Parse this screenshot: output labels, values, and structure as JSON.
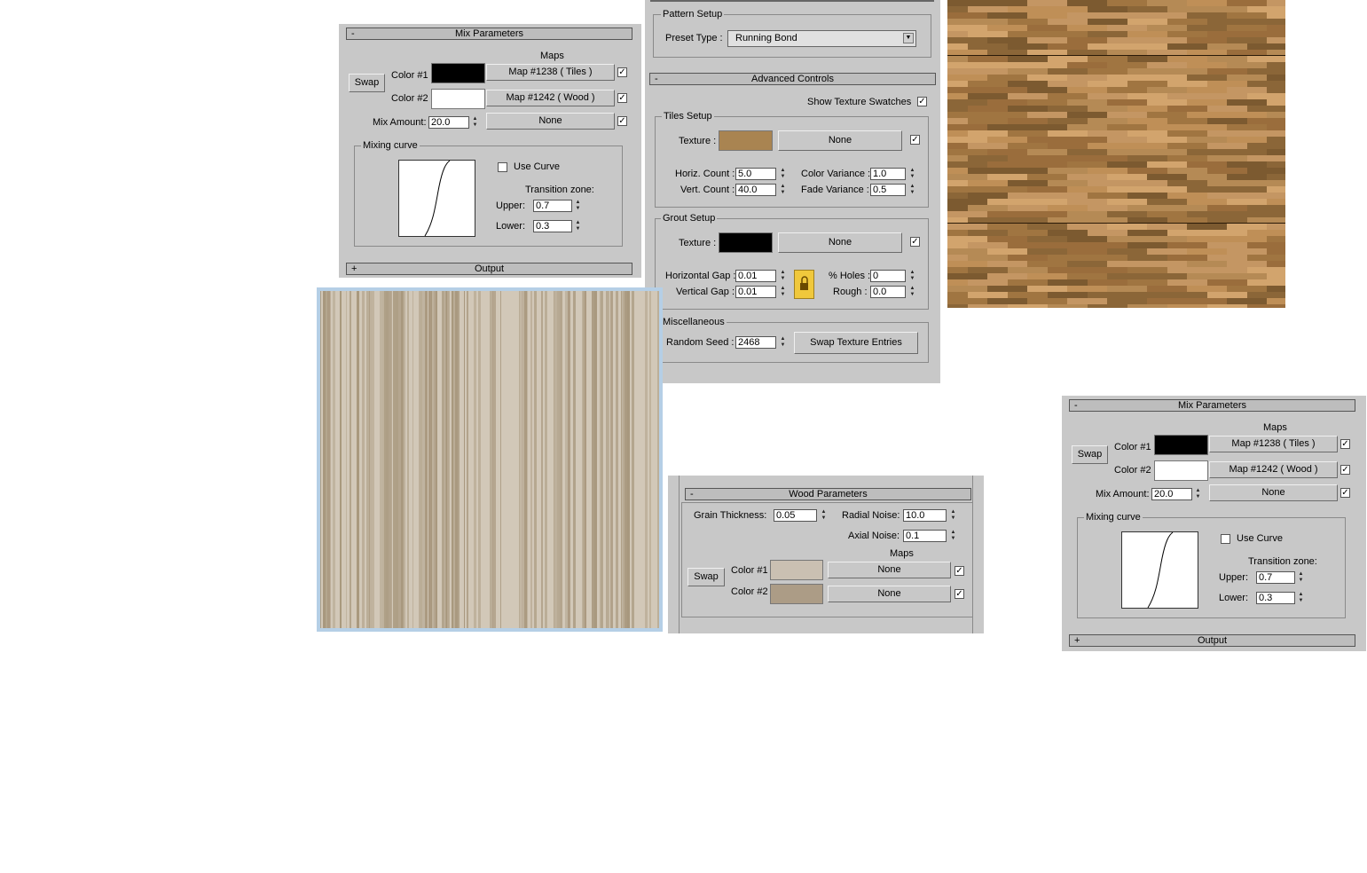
{
  "mix1": {
    "title": "Mix Parameters",
    "collapse_sign": "-",
    "maps_header": "Maps",
    "swap_label": "Swap",
    "color1_label": "Color #1",
    "color1_hex": "#000000",
    "color1_map": "Map #1238  ( Tiles )",
    "color2_label": "Color #2",
    "color2_hex": "#ffffff",
    "color2_map": "Map #1242  ( Wood )",
    "mix_amount_label": "Mix Amount:",
    "mix_amount_value": "20.0",
    "mix_map": "None",
    "mixing_curve_label": "Mixing curve",
    "use_curve_label": "Use Curve",
    "transition_zone_label": "Transition zone:",
    "upper_label": "Upper:",
    "upper_value": "0.7",
    "lower_label": "Lower:",
    "lower_value": "0.3",
    "output_label": "Output",
    "output_sign": "+",
    "check_mark": "✓"
  },
  "mix2": {
    "title": "Mix Parameters",
    "collapse_sign": "-",
    "maps_header": "Maps",
    "swap_label": "Swap",
    "color1_label": "Color #1",
    "color1_hex": "#000000",
    "color1_map": "Map #1238  ( Tiles )",
    "color2_label": "Color #2",
    "color2_hex": "#ffffff",
    "color2_map": "Map #1242  ( Wood )",
    "mix_amount_label": "Mix Amount:",
    "mix_amount_value": "20.0",
    "mix_map": "None",
    "mixing_curve_label": "Mixing curve",
    "use_curve_label": "Use Curve",
    "transition_zone_label": "Transition zone:",
    "upper_label": "Upper:",
    "upper_value": "0.7",
    "lower_label": "Lower:",
    "lower_value": "0.3",
    "output_label": "Output",
    "output_sign": "+",
    "check_mark": "✓"
  },
  "tiles": {
    "pattern_setup_label": "Pattern Setup",
    "preset_type_label": "Preset Type :",
    "preset_type_value": "Running Bond",
    "advanced_controls_title": "Advanced Controls",
    "collapse_sign": "-",
    "show_swatches_label": "Show Texture Swatches",
    "tiles_setup_label": "Tiles Setup",
    "tiles_texture_label": "Texture :",
    "tiles_texture_hex": "#a98451",
    "tiles_texture_map": "None",
    "horiz_count_label": "Horiz. Count :",
    "horiz_count_value": "5.0",
    "vert_count_label": "Vert. Count :",
    "vert_count_value": "40.0",
    "color_variance_label": "Color Variance :",
    "color_variance_value": "1.0",
    "fade_variance_label": "Fade Variance :",
    "fade_variance_value": "0.5",
    "grout_setup_label": "Grout Setup",
    "grout_texture_label": "Texture :",
    "grout_texture_hex": "#000000",
    "grout_texture_map": "None",
    "horizontal_gap_label": "Horizontal Gap :",
    "horizontal_gap_value": "0.01",
    "vertical_gap_label": "Vertical Gap :",
    "vertical_gap_value": "0.01",
    "holes_label": "% Holes :",
    "holes_value": "0",
    "rough_label": "Rough :",
    "rough_value": "0.0",
    "misc_label": "Miscellaneous",
    "random_seed_label": "Random Seed :",
    "random_seed_value": "2468",
    "swap_entries_label": "Swap Texture Entries",
    "check_mark": "✓"
  },
  "wood": {
    "title": "Wood Parameters",
    "collapse_sign": "-",
    "grain_thickness_label": "Grain Thickness:",
    "grain_thickness_value": "0.05",
    "radial_noise_label": "Radial Noise:",
    "radial_noise_value": "10.0",
    "axial_noise_label": "Axial Noise:",
    "axial_noise_value": "0.1",
    "maps_header": "Maps",
    "swap_label": "Swap",
    "color1_label": "Color #1",
    "color1_hex": "#cac0b2",
    "color1_map": "None",
    "color2_label": "Color #2",
    "color2_hex": "#ac9c86",
    "color2_map": "None",
    "check_mark": "✓"
  },
  "colors": {
    "panel_bg": "#c8c8c8",
    "lock_button": "#f0c83c",
    "wood_grain_light": "#d2c8b8",
    "wood_grain_dark": "#a49378",
    "tile_mid": "#b58a55"
  }
}
